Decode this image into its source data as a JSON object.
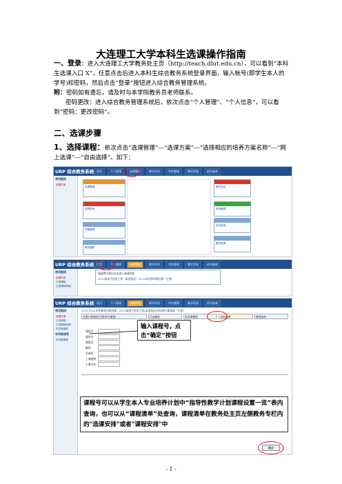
{
  "doc": {
    "title": "大连理工大学本科生选课操作指南",
    "s1_heading": "一、登录",
    "s1_text": "：进入大连理工大学教务处主页（http://teach.dlut.edu.cn），可以看到“本科生选课入口 X”，任意点击后进入本科生综合教务系统登录界面，输入帐号(即学生本人的学号)和密码，然后点击“登录”按钮进入综合教务管理系统。",
    "note_label": "附：",
    "note_text": "密码如有遗忘，请及时与本学院教务员老师联系。",
    "pwd_text": "密码更改：进入综合教务管理系统后，依次点击“个人管理”、“个人信息”，可以看到“密码：更改密码”。",
    "s2_heading": "二、选课步骤",
    "step1_label": "1、选择课程：",
    "step1_text": "依次点击“选课管理”---“选课方案”---“选择相应的培养方案名称”---“网上选课”---“自由选择”。如下：",
    "page_number": "- 1 -"
  },
  "screens": {
    "logo": "URP 综合教务系统",
    "tabs": [
      "首页",
      "个人管理",
      "选课管理",
      "教学评估",
      "考务管理",
      "教学资源",
      "综合查询"
    ],
    "side_head": "常用链接",
    "side_items": [
      "选课方案",
      "已选课程",
      "已选课程明细",
      "本学期课表"
    ],
    "side_head2": "本学期课表",
    "side_item2": "本学期课表",
    "panels": [
      "选课管理",
      "成绩查询",
      "学籍管理",
      "教务通知",
      "教学评估",
      "考务管理",
      "综合查询",
      "教学资源",
      "实验选课",
      "学籍异动",
      "考试报名",
      "选课方案"
    ],
    "s2_line1": "请选择方案后点击进入选课页面",
    "s2_line2": "2011级电子信息工程（英语强化）2011年秋季学期方案（主修）",
    "s3_header": "2011-2012学年春季学期选课：2011级电子信息工程(英语强化)的培养方案选课（主修）",
    "s3_tabs": [
      "方案计划课程(可按学分课程)",
      "已选课程",
      "本学期课程",
      "自由选择",
      "课程查询"
    ],
    "form_labels": [
      "课程号",
      "课序号",
      "课程名",
      "教师",
      "开课系",
      "上课星期",
      "上课节次"
    ],
    "confirm_btn": "确定",
    "callout1": "输入课程号，点击“确定”按钮",
    "callout2": "课程号可以从学生本人专业培养计划中“指导性教学计划课程设置一览”表内查询，也可以从“课程清单”处查询，课程清单在教务处主页左侧教务专栏内的\"选课安排\"或者\"课程安排\"中"
  }
}
